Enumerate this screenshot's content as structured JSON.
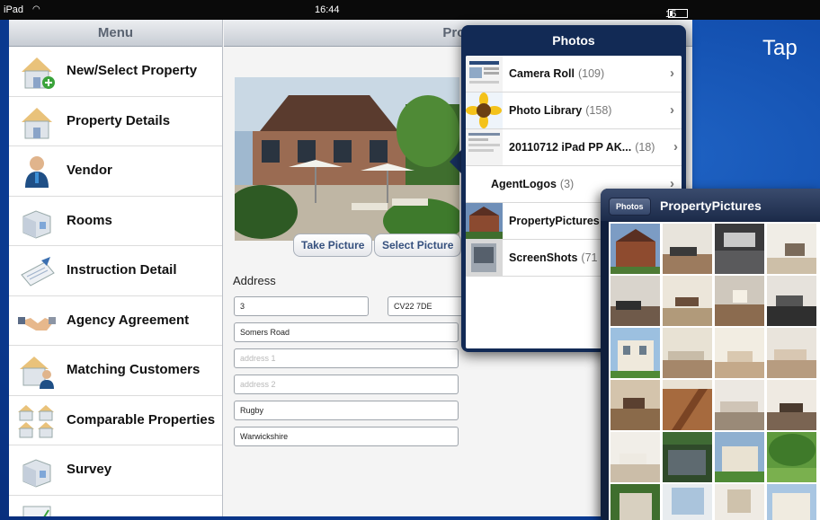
{
  "status_bar": {
    "device": "iPad",
    "time": "16:44",
    "battery": "15 %"
  },
  "menu": {
    "title": "Menu",
    "items": [
      {
        "label": "New/Select Property",
        "icon": "house-add-icon"
      },
      {
        "label": "Property Details",
        "icon": "house-icon"
      },
      {
        "label": "Vendor",
        "icon": "person-icon"
      },
      {
        "label": "Rooms",
        "icon": "room-icon"
      },
      {
        "label": "Instruction Detail",
        "icon": "document-pen-icon"
      },
      {
        "label": "Agency Agreement",
        "icon": "handshake-icon"
      },
      {
        "label": "Matching Customers",
        "icon": "house-person-icon"
      },
      {
        "label": "Comparable Properties",
        "icon": "houses-icon"
      },
      {
        "label": "Survey",
        "icon": "room-icon"
      }
    ]
  },
  "detail": {
    "title": "Prop",
    "take_picture": "Take Picture",
    "select_picture": "Select Picture",
    "address_label": "Address",
    "fields": {
      "number": "3",
      "postcode": "CV22 7DE",
      "street": "Somers Road",
      "address1_placeholder": "address 1",
      "address2_placeholder": "address 2",
      "town": "Rugby",
      "county": "Warwickshire"
    }
  },
  "photos_popover": {
    "title": "Photos",
    "albums": [
      {
        "name": "Camera Roll",
        "count": "(109)"
      },
      {
        "name": "Photo Library",
        "count": "(158)"
      },
      {
        "name": "20110712 iPad PP AK...",
        "count": "(18)"
      },
      {
        "name": "AgentLogos",
        "count": "(3)"
      },
      {
        "name": "PropertyPictures",
        "count": ""
      },
      {
        "name": "ScreenShots",
        "count": "(71"
      }
    ]
  },
  "property_pictures": {
    "back_label": "Photos",
    "title": "PropertyPictures"
  },
  "caption": "Tap"
}
